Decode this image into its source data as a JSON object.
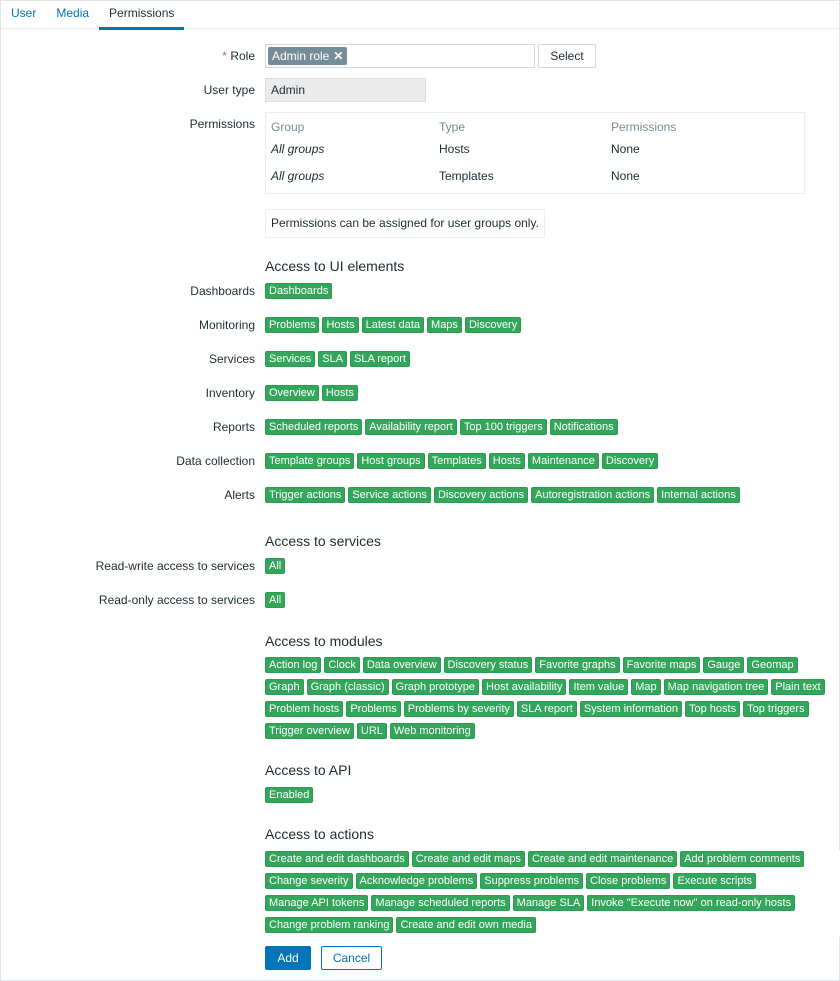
{
  "tabs": [
    {
      "label": "User",
      "active": false
    },
    {
      "label": "Media",
      "active": false
    },
    {
      "label": "Permissions",
      "active": true
    }
  ],
  "form": {
    "role": {
      "label": "Role",
      "required_mark": "*",
      "selected": "Admin role",
      "remove_icon": "close-icon",
      "select_button": "Select"
    },
    "user_type": {
      "label": "User type",
      "value": "Admin"
    },
    "permissions": {
      "label": "Permissions",
      "columns": [
        "Group",
        "Type",
        "Permissions"
      ],
      "rows": [
        {
          "group": "All groups",
          "type": "Hosts",
          "permission": "None"
        },
        {
          "group": "All groups",
          "type": "Templates",
          "permission": "None"
        }
      ],
      "note": "Permissions can be assigned for user groups only."
    }
  },
  "ui_elements": {
    "title": "Access to UI elements",
    "rows": [
      {
        "label": "Dashboards",
        "tags": [
          "Dashboards"
        ]
      },
      {
        "label": "Monitoring",
        "tags": [
          "Problems",
          "Hosts",
          "Latest data",
          "Maps",
          "Discovery"
        ]
      },
      {
        "label": "Services",
        "tags": [
          "Services",
          "SLA",
          "SLA report"
        ]
      },
      {
        "label": "Inventory",
        "tags": [
          "Overview",
          "Hosts"
        ]
      },
      {
        "label": "Reports",
        "tags": [
          "Scheduled reports",
          "Availability report",
          "Top 100 triggers",
          "Notifications"
        ]
      },
      {
        "label": "Data collection",
        "tags": [
          "Template groups",
          "Host groups",
          "Templates",
          "Hosts",
          "Maintenance",
          "Discovery"
        ]
      },
      {
        "label": "Alerts",
        "tags": [
          "Trigger actions",
          "Service actions",
          "Discovery actions",
          "Autoregistration actions",
          "Internal actions"
        ]
      }
    ]
  },
  "services": {
    "title": "Access to services",
    "rows": [
      {
        "label": "Read-write access to services",
        "tags": [
          "All"
        ]
      },
      {
        "label": "Read-only access to services",
        "tags": [
          "All"
        ]
      }
    ]
  },
  "modules": {
    "title": "Access to modules",
    "tags": [
      "Action log",
      "Clock",
      "Data overview",
      "Discovery status",
      "Favorite graphs",
      "Favorite maps",
      "Gauge",
      "Geomap",
      "Graph",
      "Graph (classic)",
      "Graph prototype",
      "Host availability",
      "Item value",
      "Map",
      "Map navigation tree",
      "Plain text",
      "Problem hosts",
      "Problems",
      "Problems by severity",
      "SLA report",
      "System information",
      "Top hosts",
      "Top triggers",
      "Trigger overview",
      "URL",
      "Web monitoring"
    ]
  },
  "api": {
    "title": "Access to API",
    "tags": [
      "Enabled"
    ]
  },
  "actions": {
    "title": "Access to actions",
    "tags": [
      "Create and edit dashboards",
      "Create and edit maps",
      "Create and edit maintenance",
      "Add problem comments",
      "Change severity",
      "Acknowledge problems",
      "Suppress problems",
      "Close problems",
      "Execute scripts",
      "Manage API tokens",
      "Manage scheduled reports",
      "Manage SLA",
      "Invoke \"Execute now\" on read-only hosts",
      "Change problem ranking",
      "Create and edit own media"
    ]
  },
  "buttons": {
    "add": "Add",
    "cancel": "Cancel"
  },
  "colors": {
    "accent": "#0275b8",
    "tag_green": "#34a65c",
    "chip_gray": "#768d99",
    "required": "#e45959"
  }
}
